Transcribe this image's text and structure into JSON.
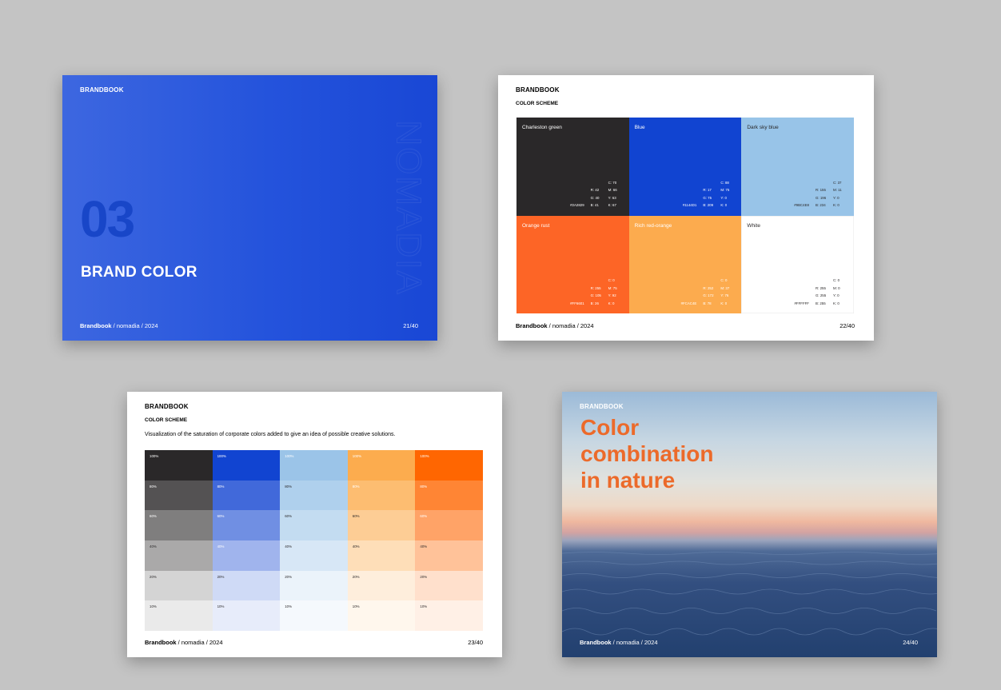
{
  "colors": {
    "background": "#c4c4c4",
    "blue": "#1846c8",
    "orange_title": "#ec6a2a"
  },
  "slide1": {
    "tag": "BRANDBOOK",
    "number": "03",
    "title": "BRAND COLOR",
    "vertical_word": "NOMADIA",
    "footer_brand": "Brandbook",
    "footer_rest": " / nomadia / 2024",
    "page": "21/40"
  },
  "slide2": {
    "tag": "BRANDBOOK",
    "subtitle": "COLOR SCHEME",
    "footer_brand": "Brandbook",
    "footer_rest": " / nomadia / 2024",
    "page": "22/40",
    "swatches": [
      {
        "name": "Charleston green",
        "color": "#2a2829",
        "text": "#ffffff",
        "hex": "#2A2829",
        "r": "R: 42",
        "g": "G: 40",
        "b": "B: 41",
        "c": "C: 70",
        "m": "M: 66",
        "y": "Y: 63",
        "k": "K: 67"
      },
      {
        "name": "Blue",
        "color": "#1144d1",
        "text": "#ffffff",
        "hex": "#1144D1",
        "r": "R: 17",
        "g": "G: 75",
        "b": "B: 209",
        "c": "C: 88",
        "m": "M: 75",
        "y": "Y: 0",
        "k": "K: 0"
      },
      {
        "name": "Dark sky blue",
        "color": "#98c4e8",
        "text": "#2a2829",
        "hex": "#9BC4E8",
        "r": "R: 155",
        "g": "G: 196",
        "b": "B: 234",
        "c": "C: 37",
        "m": "M: 11",
        "y": "Y: 0",
        "k": "K: 0"
      },
      {
        "name": "Orange rust",
        "color": "#fd6526",
        "text": "#ffffff",
        "hex": "#FF6601",
        "r": "R: 255",
        "g": "G: 105",
        "b": "B: 26",
        "c": "C: 0",
        "m": "M: 75",
        "y": "Y: 92",
        "k": "K: 0"
      },
      {
        "name": "Rich red-orange",
        "color": "#fcab4e",
        "text": "#ffffff",
        "hex": "#FCAC4E",
        "r": "R: 252",
        "g": "G: 172",
        "b": "B: 78",
        "c": "C: 0",
        "m": "M: 37",
        "y": "Y: 76",
        "k": "K: 0"
      },
      {
        "name": "White",
        "color": "#ffffff",
        "text": "#2a2829",
        "hex": "#FFFFFF",
        "r": "R: 255",
        "g": "G: 255",
        "b": "B: 255",
        "c": "C: 0",
        "m": "M: 0",
        "y": "Y: 0",
        "k": "K: 0"
      }
    ]
  },
  "slide3": {
    "tag": "BRANDBOOK",
    "subtitle": "COLOR SCHEME",
    "description": "Visualization of the saturation of corporate colors added to give an idea of possible creative solutions.",
    "footer_brand": "Brandbook",
    "footer_rest": " / nomadia / 2024",
    "page": "23/40",
    "levels": [
      "100%",
      "80%",
      "60%",
      "40%",
      "20%",
      "10%"
    ],
    "columns": [
      {
        "cells": [
          "#2a2829",
          "#545253",
          "#7f7e7e",
          "#aaa9a9",
          "#d4d4d4",
          "#eaeaea"
        ]
      },
      {
        "cells": [
          "#1144d1",
          "#4169da",
          "#708fe3",
          "#a0b4ed",
          "#cfdaf6",
          "#e7ecfa"
        ]
      },
      {
        "cells": [
          "#9bc4e8",
          "#afd0ed",
          "#c3dcf1",
          "#d7e7f6",
          "#ebf3fa",
          "#f5f9fd"
        ]
      },
      {
        "cells": [
          "#fcac4e",
          "#fdbd71",
          "#fdcd95",
          "#fedeb8",
          "#feeedc",
          "#fff7ed"
        ]
      },
      {
        "cells": [
          "#ff6601",
          "#ff8534",
          "#ffa367",
          "#ffc299",
          "#ffe0cc",
          "#fff0e6"
        ]
      }
    ]
  },
  "slide4": {
    "tag": "BRANDBOOK",
    "title_lines": [
      "Color",
      "combination",
      "in nature"
    ],
    "footer_brand": "Brandbook",
    "footer_rest": " / nomadia / 2024",
    "page": "24/40"
  }
}
